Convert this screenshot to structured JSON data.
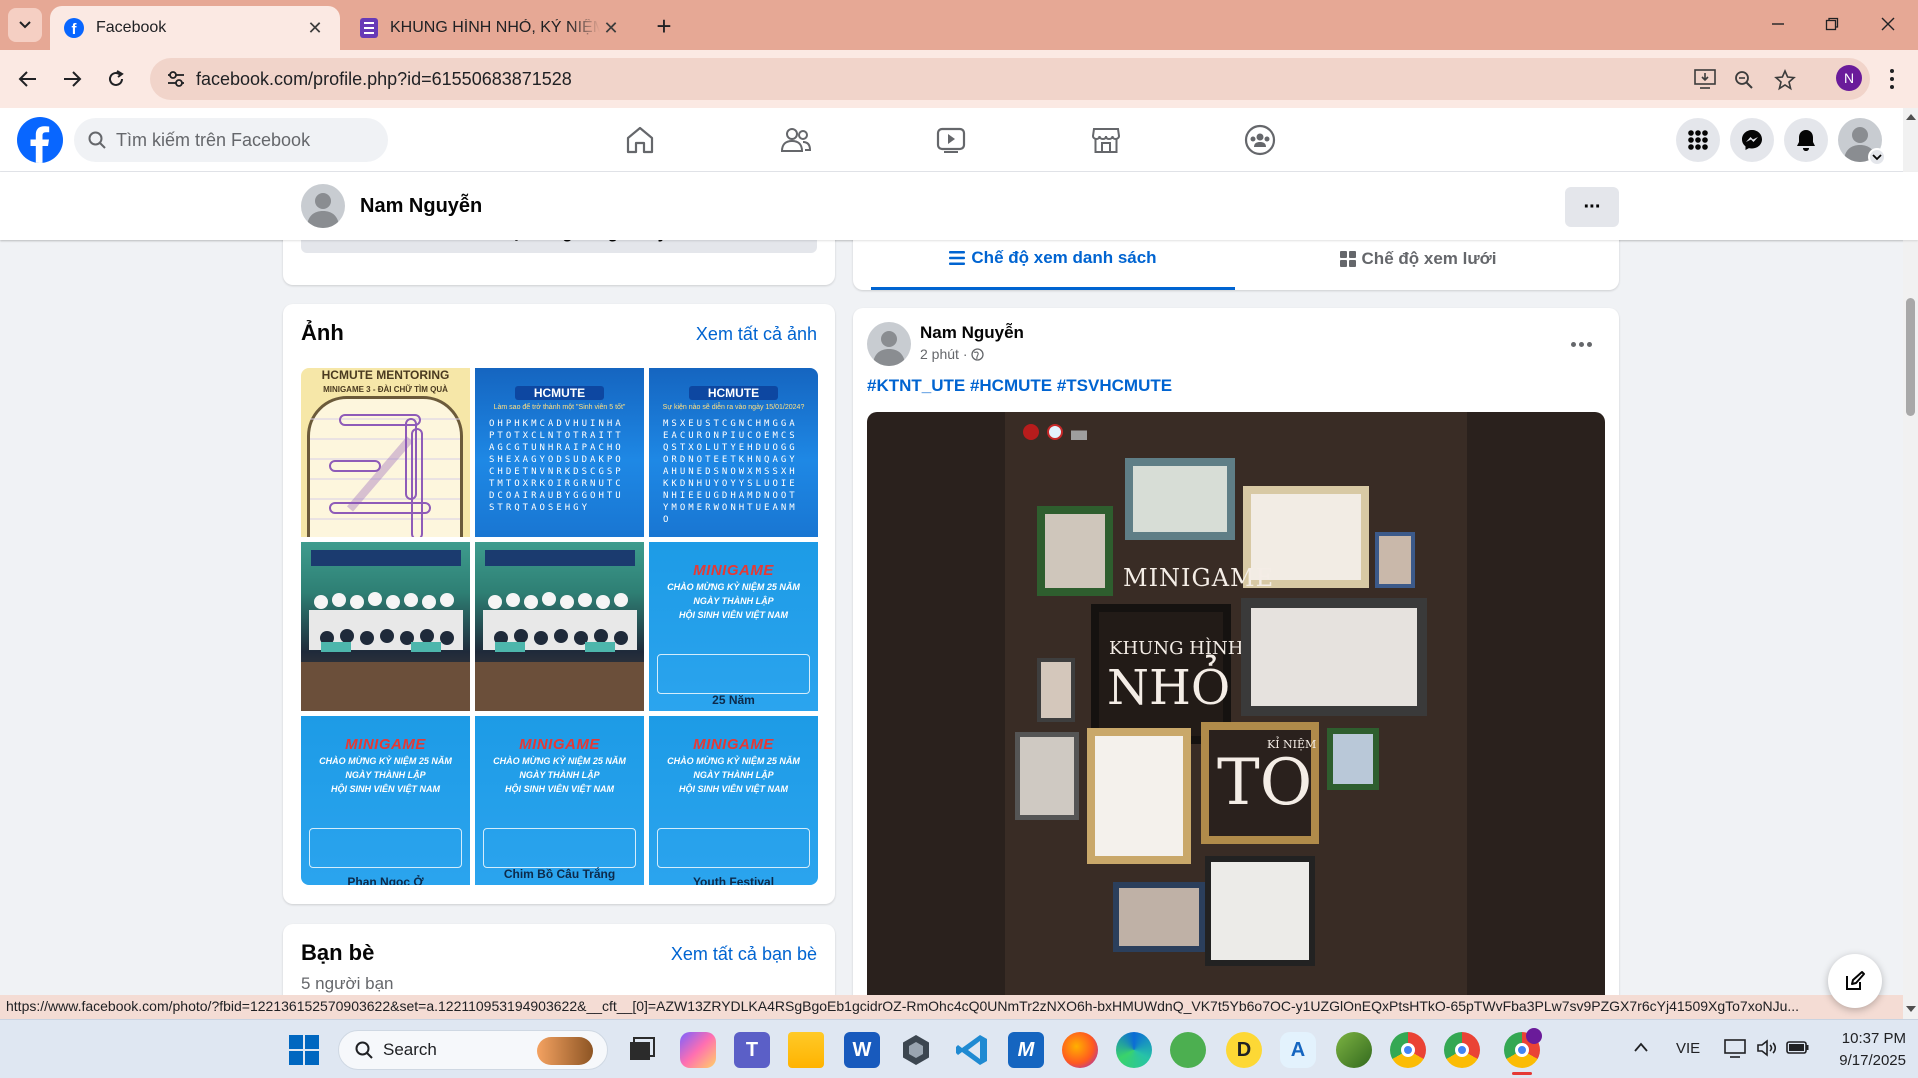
{
  "browser": {
    "tabs": [
      {
        "title": "Facebook",
        "active": true
      },
      {
        "title": "KHUNG HÌNH NHỎ, KỶ NIỆM TO",
        "active": false
      }
    ],
    "new_tab_label": "+",
    "url": "facebook.com/profile.php?id=61550683871528",
    "profile_initial": "N"
  },
  "facebook": {
    "search_placeholder": "Tìm kiếm trên Facebook",
    "profile_name": "Nam Nguyễn",
    "more_label": "···"
  },
  "left_column": {
    "featured_button": "Thêm nội dung đáng chú ý",
    "photos": {
      "heading": "Ảnh",
      "see_all": "Xem tất cả ảnh",
      "tiles": [
        {
          "kind": "wordsearch-yellow",
          "title": "HCMUTE MENTORING",
          "subtitle": "MINIGAME 3 - ĐÀI CHỮ TÌM QUÀ"
        },
        {
          "kind": "wordsearch-blue",
          "header": "HCMUTE",
          "question": "Làm sao để trở thành một \"Sinh viên 5 tốt\""
        },
        {
          "kind": "wordsearch-blue",
          "header": "HCMUTE",
          "question": "Sự kiện nào sẽ diễn ra vào ngày 15/01/2024?"
        },
        {
          "kind": "class-photo"
        },
        {
          "kind": "class-photo"
        },
        {
          "kind": "minigame",
          "title": "MINIGAME",
          "line1": "CHÀO MỪNG KỶ NIỆM 25 NĂM",
          "line2": "NGÀY THÀNH LẬP",
          "line3": "HỘI SINH VIÊN VIỆT NAM",
          "answer": "25 Năm"
        },
        {
          "kind": "minigame",
          "title": "MINIGAME",
          "line1": "CHÀO MỪNG KỶ NIỆM 25 NĂM",
          "line2": "NGÀY THÀNH LẬP",
          "line3": "HỘI SINH VIÊN VIỆT NAM",
          "answer": "Phan Ngọc Ở"
        },
        {
          "kind": "minigame",
          "title": "MINIGAME",
          "line1": "CHÀO MỪNG KỶ NIỆM 25 NĂM",
          "line2": "NGÀY THÀNH LẬP",
          "line3": "HỘI SINH VIÊN VIỆT NAM",
          "answer": "Chim Bồ Câu Trắng"
        },
        {
          "kind": "minigame",
          "title": "MINIGAME",
          "line1": "CHÀO MỪNG KỶ NIỆM 25 NĂM",
          "line2": "NGÀY THÀNH LẬP",
          "line3": "HỘI SINH VIÊN VIỆT NAM",
          "answer": "Youth Festival"
        }
      ]
    },
    "friends": {
      "heading": "Bạn bè",
      "see_all": "Xem tất cả bạn bè",
      "count_text": "5 người bạn"
    }
  },
  "right_column": {
    "view_tabs": {
      "list": "Chế độ xem danh sách",
      "grid": "Chế độ xem lưới"
    },
    "post": {
      "author": "Nam Nguyễn",
      "time": "2 phút ·",
      "hashtags": "#KTNT_UTE #HCMUTE #TSVHCMUTE",
      "image": {
        "word_minigame": "MINIGAME",
        "word_khung_hinh": "KHUNG HÌNH",
        "word_nho": "NHỎ",
        "word_ki_niem": "KỈ NIỆM",
        "word_to": "TO"
      }
    }
  },
  "status_url": "https://www.facebook.com/photo/?fbid=122136152570903622&set=a.122110953194903622&__cft__[0]=AZW13ZRYDLKA4RSgBgoEb1gcidrOZ-RmOhc4cQ0UNmTr2zNXO6h-bxHMUWdnQ_VK7t5Yb6o7OC-y1UZGlOnEQxPtsHTkO-65pTWvFba3PLw7sv9PZGX7r6cYj41509XgTo7xoNJu...",
  "taskbar": {
    "search_label": "Search",
    "language": "VIE",
    "time": "10:37 PM",
    "date": "9/17/2025"
  },
  "colors": {
    "fb_blue": "#0866ff",
    "link_blue": "#0064d1",
    "chrome_tab_bg": "#e6a895",
    "chrome_toolbar": "#fbe9e3"
  }
}
